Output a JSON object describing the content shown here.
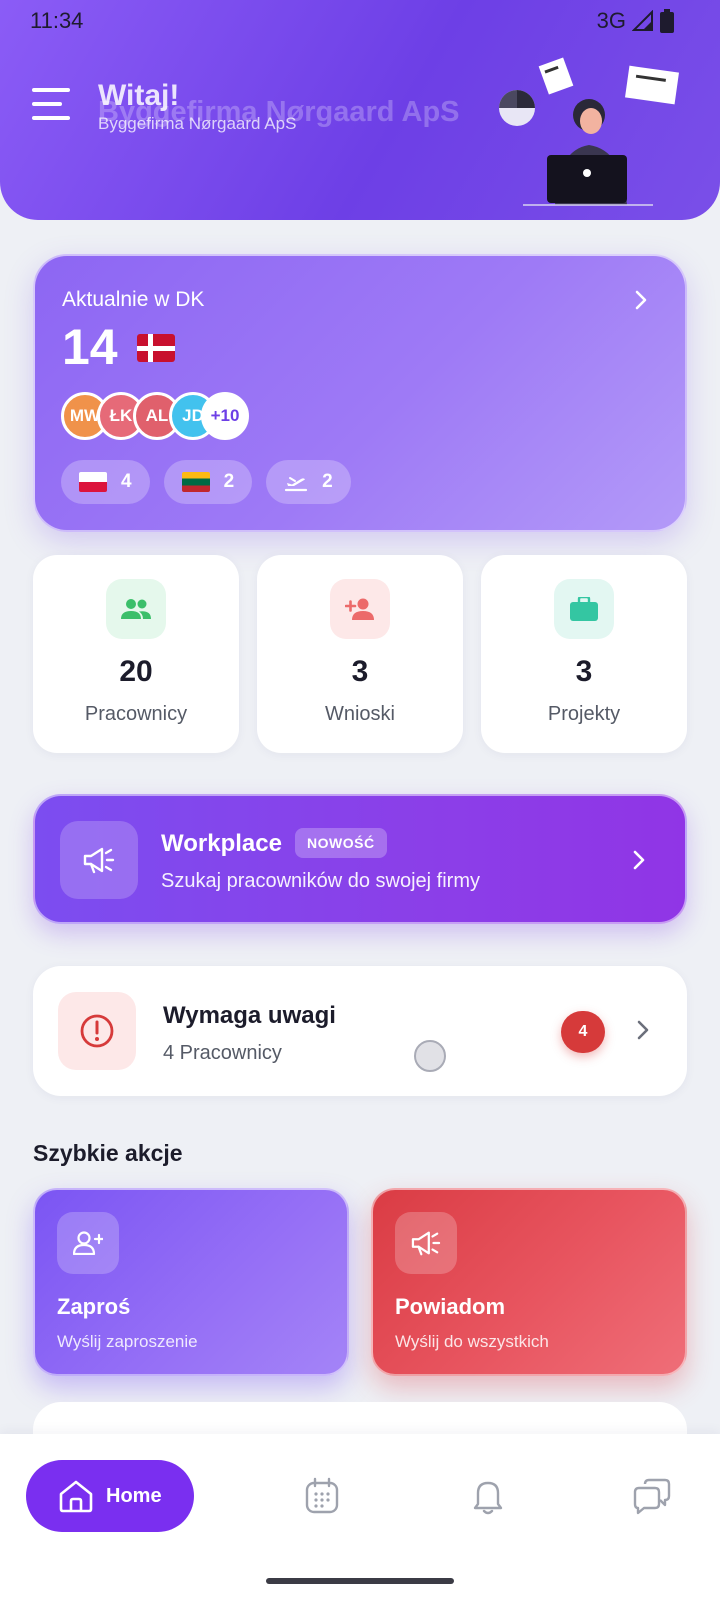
{
  "status_bar": {
    "time": "11:34",
    "network": "3G"
  },
  "header": {
    "greeting": "Witaj!",
    "company": "Byggefirma Nørgaard ApS"
  },
  "current_card": {
    "label": "Aktualnie w DK",
    "count": "14",
    "avatars": [
      {
        "initials": "MW",
        "color": "#f0924a"
      },
      {
        "initials": "ŁK",
        "color": "#e66a78"
      },
      {
        "initials": "AL",
        "color": "#e0606c"
      },
      {
        "initials": "JD",
        "color": "#42c2ee"
      }
    ],
    "more": "+10",
    "chips": [
      {
        "icon": "poland-flag",
        "value": "4"
      },
      {
        "icon": "lithuania-flag",
        "value": "2"
      },
      {
        "icon": "plane-takeoff-icon",
        "value": "2"
      }
    ]
  },
  "stats": [
    {
      "value": "20",
      "label": "Pracownicy",
      "icon": "people-icon",
      "icon_color": "#3bbf6a",
      "bg": "#e5f8ec"
    },
    {
      "value": "3",
      "label": "Wnioski",
      "icon": "person-add-icon",
      "icon_color": "#ec6a6a",
      "bg": "#fde8e8"
    },
    {
      "value": "3",
      "label": "Projekty",
      "icon": "briefcase-icon",
      "icon_color": "#34c6a2",
      "bg": "#e3f7f2"
    }
  ],
  "workplace": {
    "title": "Workplace",
    "badge": "NOWOŚĆ",
    "subtitle": "Szukaj pracowników do swojej firmy"
  },
  "attention": {
    "title": "Wymaga uwagi",
    "subtitle": "4 Pracownicy",
    "count": "4"
  },
  "quick_actions": {
    "title": "Szybkie akcje",
    "items": [
      {
        "title": "Zaproś",
        "subtitle": "Wyślij zaproszenie",
        "icon": "person-add-icon"
      },
      {
        "title": "Powiadom",
        "subtitle": "Wyślij do wszystkich",
        "icon": "megaphone-icon"
      }
    ]
  },
  "bottom_nav": {
    "home_label": "Home",
    "items": [
      "calendar-icon",
      "bell-icon",
      "chat-icon"
    ]
  },
  "colors": {
    "primary": "#7a2ff0",
    "danger": "#d63a3a",
    "background": "#eef0f5"
  }
}
